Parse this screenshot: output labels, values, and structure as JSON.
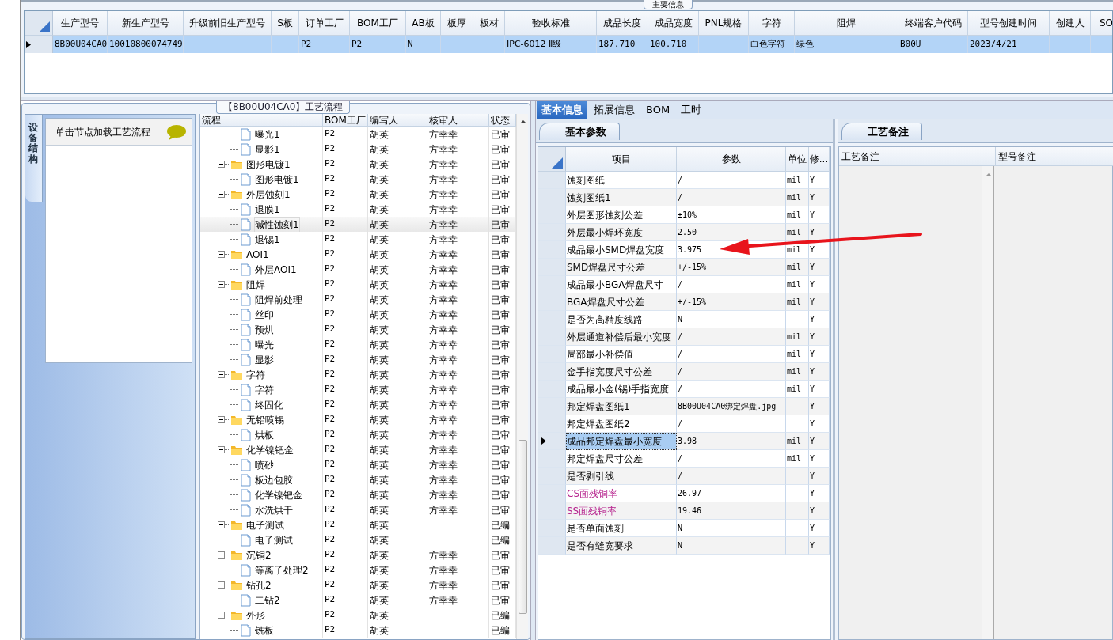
{
  "main_info": {
    "title": "主要信息"
  },
  "main_table": {
    "columns": [
      "生产型号",
      "新生产型号",
      "升级前旧生产型号",
      "S板",
      "订单工厂",
      "BOM工厂",
      "AB板",
      "板厚",
      "板材",
      "验收标准",
      "成品长度",
      "成品宽度",
      "PNL规格",
      "字符",
      "阻焊",
      "终端客户代码",
      "型号创建时间",
      "创建人",
      "SO"
    ],
    "rows": [
      {
        "selected": true,
        "cells": [
          "8B00U04CA0",
          "10010800074749",
          null,
          null,
          "P2",
          "P2",
          "N",
          null,
          null,
          "IPC-6012 Ⅱ级",
          "187.710",
          "100.710",
          null,
          "白色字符",
          "绿色",
          "B00U",
          "2023/4/21",
          null,
          null
        ]
      }
    ]
  },
  "process": {
    "title": "【8B00U04CA0】工艺流程",
    "side_tab": "设备结构",
    "hint": "单击节点加载工艺流程",
    "columns": [
      "流程",
      "BOM工厂",
      "编写人",
      "核审人",
      "状态"
    ],
    "rows": [
      {
        "children": [
          {
            "label": "曝光1",
            "bom": "P2",
            "writer": "胡英",
            "reviewer": "方幸幸",
            "status": "已审",
            "selected": false
          },
          {
            "label": "显影1",
            "bom": "P2",
            "writer": "胡英",
            "reviewer": "方幸幸",
            "status": "已审",
            "selected": false
          }
        ]
      },
      {
        "label": "图形电镀1",
        "bom": "P2",
        "writer": "胡英",
        "reviewer": "方幸幸",
        "status": "已审",
        "selected": false,
        "expanded": true,
        "children": [
          {
            "label": "图形电镀1",
            "bom": "P2",
            "writer": "胡英",
            "reviewer": "方幸幸",
            "status": "已审",
            "selected": false
          }
        ]
      },
      {
        "label": "外层蚀刻1",
        "bom": "P2",
        "writer": "胡英",
        "reviewer": "方幸幸",
        "status": "已审",
        "selected": false,
        "expanded": true,
        "children": [
          {
            "label": "退膜1",
            "bom": "P2",
            "writer": "胡英",
            "reviewer": "方幸幸",
            "status": "已审",
            "selected": false
          },
          {
            "label": "碱性蚀刻1",
            "bom": "P2",
            "writer": "胡英",
            "reviewer": "方幸幸",
            "status": "已审",
            "selected": true
          },
          {
            "label": "退锡1",
            "bom": "P2",
            "writer": "胡英",
            "reviewer": "方幸幸",
            "status": "已审",
            "selected": false
          }
        ]
      },
      {
        "label": "AOI1",
        "bom": "P2",
        "writer": "胡英",
        "reviewer": "方幸幸",
        "status": "已审",
        "selected": false,
        "expanded": true,
        "children": [
          {
            "label": "外层AOI1",
            "bom": "P2",
            "writer": "胡英",
            "reviewer": "方幸幸",
            "status": "已审",
            "selected": false
          }
        ]
      },
      {
        "label": "阻焊",
        "bom": "P2",
        "writer": "胡英",
        "reviewer": "方幸幸",
        "status": "已审",
        "selected": false,
        "expanded": true,
        "children": [
          {
            "label": "阻焊前处理",
            "bom": "P2",
            "writer": "胡英",
            "reviewer": "方幸幸",
            "status": "已审",
            "selected": false
          },
          {
            "label": "丝印",
            "bom": "P2",
            "writer": "胡英",
            "reviewer": "方幸幸",
            "status": "已审",
            "selected": false
          },
          {
            "label": "预烘",
            "bom": "P2",
            "writer": "胡英",
            "reviewer": "方幸幸",
            "status": "已审",
            "selected": false
          },
          {
            "label": "曝光",
            "bom": "P2",
            "writer": "胡英",
            "reviewer": "方幸幸",
            "status": "已审",
            "selected": false
          },
          {
            "label": "显影",
            "bom": "P2",
            "writer": "胡英",
            "reviewer": "方幸幸",
            "status": "已审",
            "selected": false
          }
        ]
      },
      {
        "label": "字符",
        "bom": "P2",
        "writer": "胡英",
        "reviewer": "方幸幸",
        "status": "已审",
        "selected": false,
        "expanded": true,
        "children": [
          {
            "label": "字符",
            "bom": "P2",
            "writer": "胡英",
            "reviewer": "方幸幸",
            "status": "已审",
            "selected": false
          },
          {
            "label": "终固化",
            "bom": "P2",
            "writer": "胡英",
            "reviewer": "方幸幸",
            "status": "已审",
            "selected": false
          }
        ]
      },
      {
        "label": "无铅喷锡",
        "bom": "P2",
        "writer": "胡英",
        "reviewer": "方幸幸",
        "status": "已审",
        "selected": false,
        "expanded": true,
        "children": [
          {
            "label": "烘板",
            "bom": "P2",
            "writer": "胡英",
            "reviewer": "方幸幸",
            "status": "已审",
            "selected": false
          }
        ]
      },
      {
        "label": "化学镍钯金",
        "bom": "P2",
        "writer": "胡英",
        "reviewer": "方幸幸",
        "status": "已审",
        "selected": false,
        "expanded": true,
        "children": [
          {
            "label": "喷砂",
            "bom": "P2",
            "writer": "胡英",
            "reviewer": "方幸幸",
            "status": "已审",
            "selected": false
          },
          {
            "label": "板边包胶",
            "bom": "P2",
            "writer": "胡英",
            "reviewer": "方幸幸",
            "status": "已审",
            "selected": false
          },
          {
            "label": "化学镍钯金",
            "bom": "P2",
            "writer": "胡英",
            "reviewer": "方幸幸",
            "status": "已审",
            "selected": false
          },
          {
            "label": "水洗烘干",
            "bom": "P2",
            "writer": "胡英",
            "reviewer": "方幸幸",
            "status": "已审",
            "selected": false
          }
        ]
      },
      {
        "label": "电子测试",
        "bom": "P2",
        "writer": "胡英",
        "status": "已编",
        "selected": false,
        "expanded": true,
        "children": [
          {
            "label": "电子测试",
            "bom": "P2",
            "writer": "胡英",
            "status": "已编",
            "selected": false
          }
        ]
      },
      {
        "label": "沉铜2",
        "bom": "P2",
        "writer": "胡英",
        "reviewer": "方幸幸",
        "status": "已审",
        "selected": false,
        "expanded": true,
        "children": [
          {
            "label": "等离子处理2",
            "bom": "P2",
            "writer": "胡英",
            "reviewer": "方幸幸",
            "status": "已审",
            "selected": false
          }
        ]
      },
      {
        "label": "钻孔2",
        "bom": "P2",
        "writer": "胡英",
        "reviewer": "方幸幸",
        "status": "已审",
        "selected": false,
        "expanded": true,
        "children": [
          {
            "label": "二钻2",
            "bom": "P2",
            "writer": "胡英",
            "reviewer": "方幸幸",
            "status": "已审",
            "selected": false
          }
        ]
      },
      {
        "label": "外形",
        "bom": "P2",
        "writer": "胡英",
        "status": "已编",
        "selected": false,
        "expanded": true,
        "children": [
          {
            "label": "铣板",
            "bom": "P2",
            "writer": "胡英",
            "status": "已编",
            "selected": false
          }
        ]
      }
    ]
  },
  "detail_tabs": [
    {
      "label": "基本信息",
      "selected": true
    },
    {
      "label": "拓展信息",
      "selected": false
    },
    {
      "label": "BOM",
      "selected": false
    },
    {
      "label": "工时",
      "selected": false
    }
  ],
  "params": {
    "tab": "基本参数",
    "columns": [
      "项目",
      "参数",
      "单位",
      "修..."
    ],
    "rows": [
      {
        "item": "蚀刻图纸",
        "value": "/",
        "unit": "mil",
        "modifiable": "Y",
        "selected": false
      },
      {
        "item": "蚀刻图纸1",
        "value": "/",
        "unit": "mil",
        "modifiable": "Y",
        "selected": false
      },
      {
        "item": "外层图形蚀刻公差",
        "value": "±10%",
        "unit": "mil",
        "modifiable": "Y",
        "selected": false
      },
      {
        "item": "外层最小焊环宽度",
        "value": "2.50",
        "unit": "mil",
        "modifiable": "Y",
        "selected": false
      },
      {
        "item": "成品最小SMD焊盘宽度",
        "value": "3.975",
        "unit": "mil",
        "modifiable": "Y",
        "selected": false
      },
      {
        "item": "SMD焊盘尺寸公差",
        "value": "+/-15%",
        "unit": "mil",
        "modifiable": "Y",
        "selected": false
      },
      {
        "item": "成品最小BGA焊盘尺寸",
        "value": "/",
        "unit": "mil",
        "modifiable": "Y",
        "selected": false
      },
      {
        "item": "BGA焊盘尺寸公差",
        "value": "+/-15%",
        "unit": "mil",
        "modifiable": "Y",
        "selected": false
      },
      {
        "item": "是否为高精度线路",
        "value": "N",
        "modifiable": "Y",
        "selected": false
      },
      {
        "item": "外层通道补偿后最小宽度",
        "value": "/",
        "unit": "mil",
        "modifiable": "Y",
        "selected": false
      },
      {
        "item": "局部最小补偿值",
        "value": "/",
        "unit": "mil",
        "modifiable": "Y",
        "selected": false
      },
      {
        "item": "金手指宽度尺寸公差",
        "value": "/",
        "unit": "mil",
        "modifiable": "Y",
        "selected": false
      },
      {
        "item": "成品最小金(锡)手指宽度",
        "value": "/",
        "unit": "mil",
        "modifiable": "Y",
        "selected": false
      },
      {
        "item": "邦定焊盘图纸1",
        "value": "8B00U04CA0绑定焊盘.jpg",
        "modifiable": "Y",
        "selected": false
      },
      {
        "item": "邦定焊盘图纸2",
        "value": "/",
        "modifiable": "Y",
        "selected": false
      },
      {
        "item": "成品邦定焊盘最小宽度",
        "value": "3.98",
        "unit": "mil",
        "modifiable": "Y",
        "selected": true
      },
      {
        "item": "邦定焊盘尺寸公差",
        "value": "/",
        "unit": "mil",
        "modifiable": "Y",
        "selected": false
      },
      {
        "item": "是否剥引线",
        "value": "/",
        "modifiable": "Y",
        "selected": false
      },
      {
        "item": "CS面残铜率",
        "value": "26.97",
        "modifiable": "Y",
        "color": "#b5208c",
        "selected": false
      },
      {
        "item": "SS面残铜率",
        "value": "19.46",
        "modifiable": "Y",
        "color": "#b5208c",
        "selected": false
      },
      {
        "item": "是否单面蚀刻",
        "value": "N",
        "modifiable": "Y",
        "selected": false
      },
      {
        "item": "是否有缝宽要求",
        "value": "N",
        "modifiable": "Y",
        "selected": false
      }
    ]
  },
  "notes": {
    "tab": "工艺备注",
    "columns": [
      "工艺备注",
      "型号备注"
    ]
  }
}
